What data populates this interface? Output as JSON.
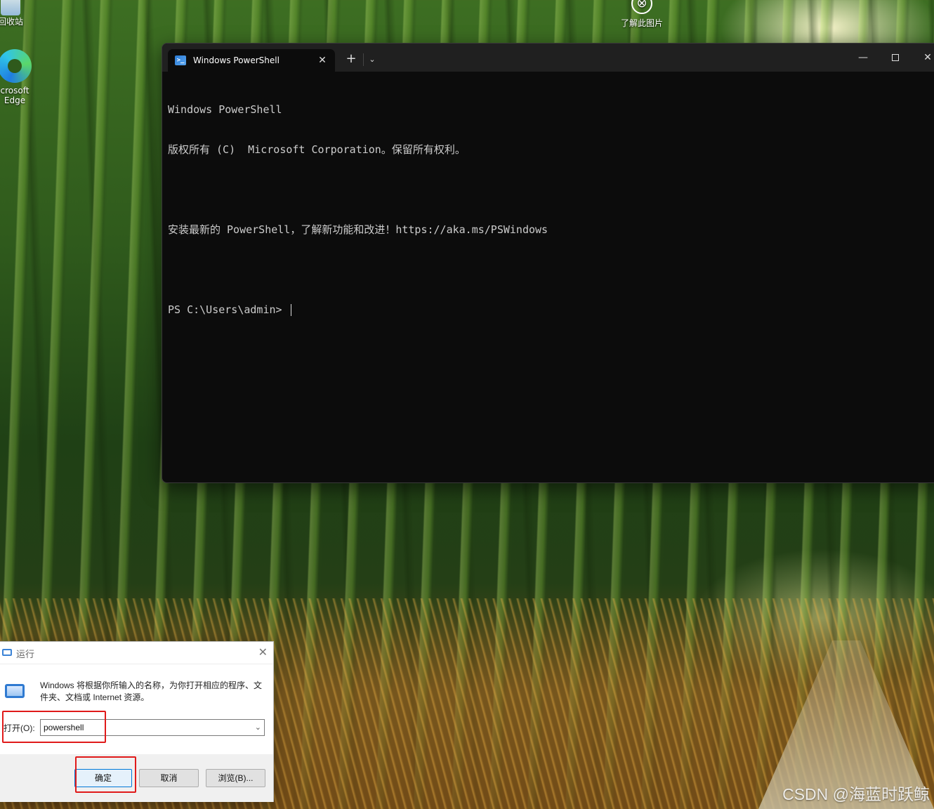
{
  "desktop": {
    "recycle_bin_label": "回收站",
    "edge_label_line1": "crosoft",
    "edge_label_line2": "Edge",
    "learn_label": "了解此图片"
  },
  "terminal": {
    "tab_title": "Windows PowerShell",
    "tab_close_glyph": "✕",
    "new_tab_glyph": "+",
    "dropdown_glyph": "⌄",
    "minimize_glyph": "—",
    "close_glyph": "✕",
    "lines": {
      "l1": "Windows PowerShell",
      "l2": "版权所有 (C)  Microsoft Corporation。保留所有权利。",
      "l3": "安装最新的 PowerShell，了解新功能和改进！https://aka.ms/PSWindows",
      "prompt": "PS C:\\Users\\admin> "
    }
  },
  "run_dialog": {
    "title": "运行",
    "close_glyph": "✕",
    "description": "Windows 将根据你所输入的名称，为你打开相应的程序、文件夹、文档或 Internet 资源。",
    "open_label": "打开(O):",
    "input_value": "powershell",
    "ok_label": "确定",
    "cancel_label": "取消",
    "browse_label": "浏览(B)..."
  },
  "watermark": "CSDN @海蓝时跃鲸",
  "colors": {
    "highlight": "#e01a1a",
    "terminal_bg": "#0c0c0c",
    "titlebar_bg": "#202020"
  }
}
